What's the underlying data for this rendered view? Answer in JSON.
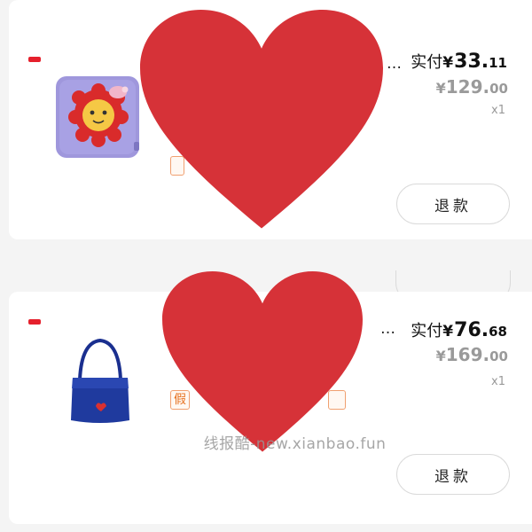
{
  "orders": [
    {
      "name_tail": "…",
      "paid_label": "实付",
      "paid_currency": "¥",
      "paid_int": "33.",
      "paid_dec": "11",
      "orig_currency": "¥",
      "orig_int": "129.",
      "orig_dec": "00",
      "quantity": "x1",
      "refund_label": "退款",
      "tag_text": "",
      "thumbnail_icon": "lion-cushion-icon"
    },
    {
      "name_tail": "…",
      "paid_label": "实付",
      "paid_currency": "¥",
      "paid_int": "76.",
      "paid_dec": "68",
      "orig_currency": "¥",
      "orig_int": "169.",
      "orig_dec": "00",
      "quantity": "x1",
      "refund_label": "退款",
      "tag_text": "假",
      "thumbnail_icon": "tote-bag-icon"
    }
  ],
  "watermark": "线报酷-new.xianbao.fun",
  "colors": {
    "heart": "#d63238",
    "brand_tag": "#e5202c",
    "tag_orange": "#e6701e",
    "muted": "#9a9a9a"
  }
}
